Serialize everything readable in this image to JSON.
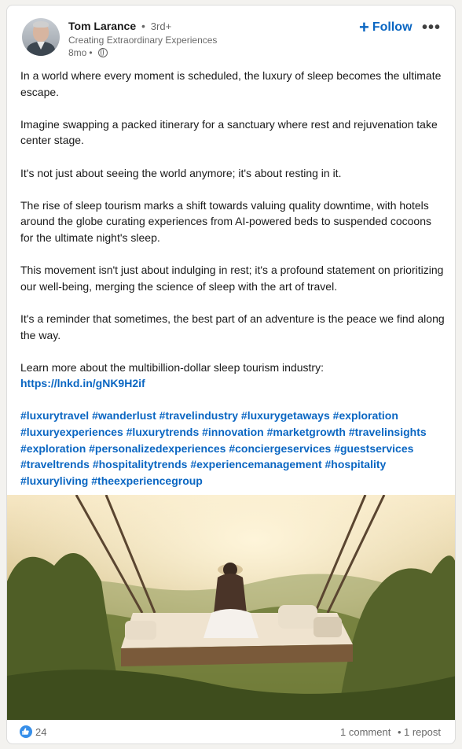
{
  "author": {
    "name": "Tom Larance",
    "degree": "3rd+",
    "headline": "Creating Extraordinary Experiences",
    "time": "8mo"
  },
  "actions": {
    "follow_label": "Follow",
    "more_icon": "more-horizontal-icon"
  },
  "post": {
    "paragraphs": [
      "In a world where every moment is scheduled, the luxury of sleep becomes the ultimate escape.",
      "Imagine swapping a packed itinerary for a sanctuary where rest and rejuvenation take center stage.",
      "It's not just about seeing the world anymore; it's about resting in it.",
      "The rise of sleep tourism marks a shift towards valuing quality downtime, with hotels around the globe curating experiences from AI-powered beds to suspended cocoons for the ultimate night's sleep.",
      "This movement isn't just about indulging in rest; it's a profound statement on prioritizing our well-being, merging the science of sleep with the art of travel.",
      "It's a reminder that sometimes, the best part of an adventure is the peace we find along the way."
    ],
    "learn_more_text": "Learn more about the multibillion-dollar sleep tourism industry:",
    "link": "https://lnkd.in/gNK9H2if",
    "hashtags": [
      "#luxurytravel",
      "#wanderlust",
      "#travelindustry",
      "#luxurygetaways",
      "#exploration",
      "#luxuryexperiences",
      "#luxurytrends",
      "#innovation",
      "#marketgrowth",
      "#travelinsights",
      "#exploration",
      "#personalizedexperiences",
      "#conciergeservices",
      "#guestservices",
      "#traveltrends",
      "#hospitalitytrends",
      "#experiencemanagement",
      "#hospitality",
      "#luxuryliving",
      "#theexperiencegroup"
    ]
  },
  "social": {
    "reactions": "24",
    "comments": "1 comment",
    "reposts": "1 repost"
  },
  "colors": {
    "brand": "#0a66c2",
    "like": "#378fe9"
  }
}
